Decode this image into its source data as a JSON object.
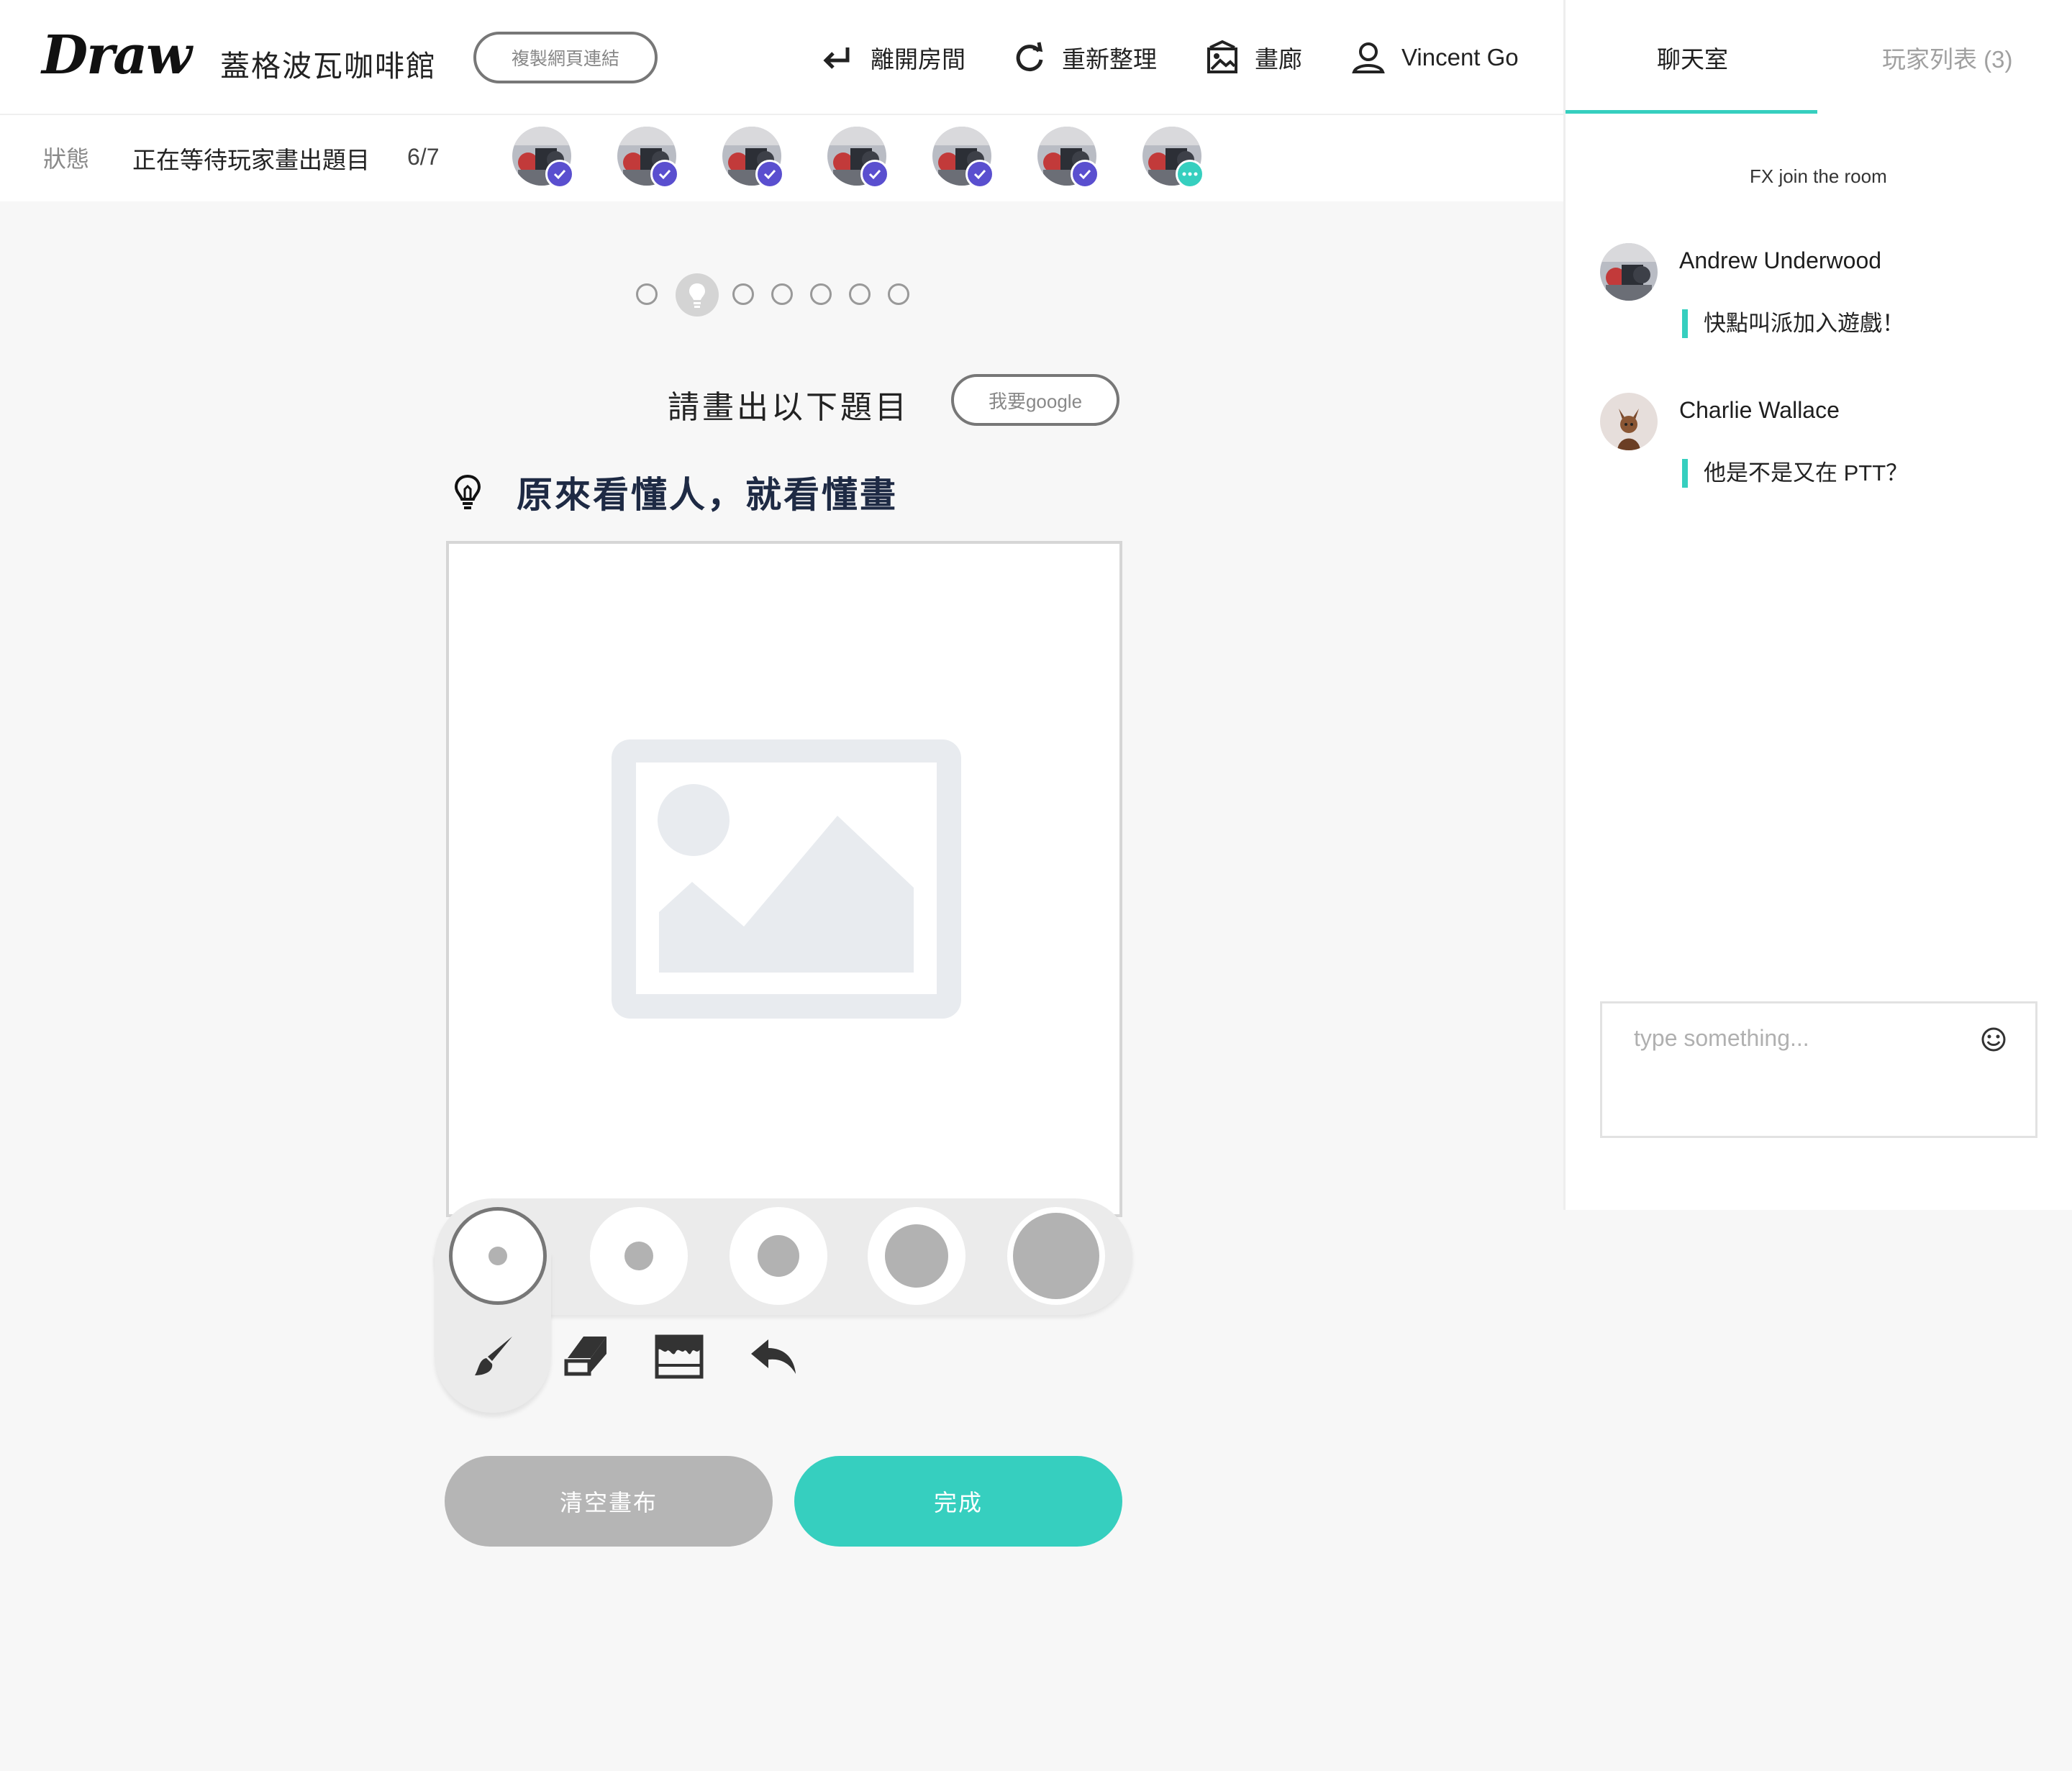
{
  "header": {
    "logo": "Draw",
    "room_name": "蓋格波瓦咖啡館",
    "copy_link_label": "複製網頁連結",
    "nav": {
      "leave_room": "離開房間",
      "refresh": "重新整理",
      "gallery": "畫廊",
      "user_name": "Vincent Go"
    }
  },
  "status_bar": {
    "label": "狀態",
    "text": "正在等待玩家畫出題目",
    "count": "6/7",
    "players": [
      {
        "state": "done"
      },
      {
        "state": "done"
      },
      {
        "state": "done"
      },
      {
        "state": "done"
      },
      {
        "state": "done"
      },
      {
        "state": "done"
      },
      {
        "state": "typing"
      }
    ]
  },
  "game": {
    "progress": {
      "total_steps": 7,
      "current_step": 2
    },
    "prompt_title": "請畫出以下題目",
    "google_button": "我要google",
    "topic": "原來看懂人，就看懂畫",
    "brush_sizes": {
      "count": 5,
      "selected_index": 0
    },
    "tools": [
      "brush",
      "eraser",
      "paint-bucket",
      "undo"
    ],
    "selected_tool": "brush",
    "clear_button": "清空畫布",
    "done_button": "完成"
  },
  "sidebar": {
    "tabs": [
      {
        "label": "聊天室",
        "active": true
      },
      {
        "label": "玩家列表 (3)",
        "active": false
      }
    ],
    "system_message": "FX join the room",
    "messages": [
      {
        "name": "Andrew Underwood",
        "text": "快點叫派加入遊戲！"
      },
      {
        "name": "Charlie Wallace",
        "text": "他是不是又在 PTT？"
      }
    ],
    "input_placeholder": "type something..."
  },
  "colors": {
    "accent": "#36cfbf",
    "check_badge": "#5a4fcf",
    "typing_badge": "#36cfbf",
    "clear_button": "#b5b5b5",
    "page_background": "#f7f7f7"
  }
}
